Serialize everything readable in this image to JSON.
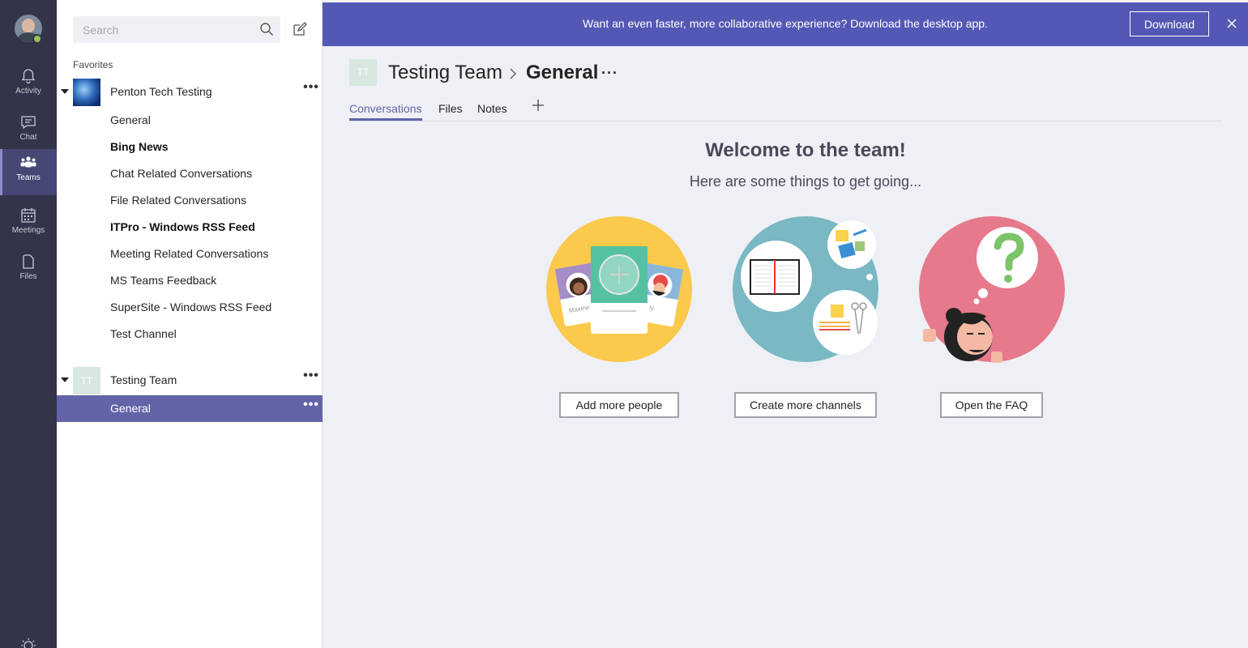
{
  "rail": {
    "items": [
      {
        "label": "Activity",
        "icon": "bell-icon"
      },
      {
        "label": "Chat",
        "icon": "chat-icon"
      },
      {
        "label": "Teams",
        "icon": "teams-icon"
      },
      {
        "label": "Meetings",
        "icon": "calendar-icon"
      },
      {
        "label": "Files",
        "icon": "file-icon"
      }
    ],
    "active": "Teams"
  },
  "sidebar": {
    "search_placeholder": "Search",
    "favorites_label": "Favorites",
    "teams": [
      {
        "name": "Penton Tech Testing",
        "channels": [
          {
            "name": "General"
          },
          {
            "name": "Bing News"
          },
          {
            "name": "Chat Related Conversations"
          },
          {
            "name": "File Related Conversations"
          },
          {
            "name": "ITPro - Windows RSS Feed"
          },
          {
            "name": "Meeting Related Conversations"
          },
          {
            "name": "MS Teams Feedback"
          },
          {
            "name": "SuperSite - Windows RSS Feed"
          },
          {
            "name": "Test Channel"
          }
        ]
      },
      {
        "name": "Testing Team",
        "initials": "TT",
        "channels": [
          {
            "name": "General"
          }
        ]
      }
    ],
    "more_glyph": "•••"
  },
  "banner": {
    "message": "Want an even faster, more collaborative experience? Download the desktop app.",
    "download_label": "Download"
  },
  "header": {
    "team_initials": "TT",
    "team_name": "Testing Team",
    "channel_name": "General",
    "more_glyph": "···"
  },
  "tabs": [
    "Conversations",
    "Files",
    "Notes"
  ],
  "welcome": {
    "title": "Welcome to the team!",
    "subtitle": "Here are some things to get going...",
    "card_name_1": "Maxine",
    "card_name_2": "ly",
    "actions": [
      "Add more people",
      "Create more channels",
      "Open the FAQ"
    ]
  },
  "colors": {
    "rail": "#33344a",
    "accent": "#6264a7",
    "banner": "#5258b4",
    "illus_people": "#fbc94b",
    "illus_channels": "#7ab8c3",
    "illus_faq": "#e6798b"
  }
}
